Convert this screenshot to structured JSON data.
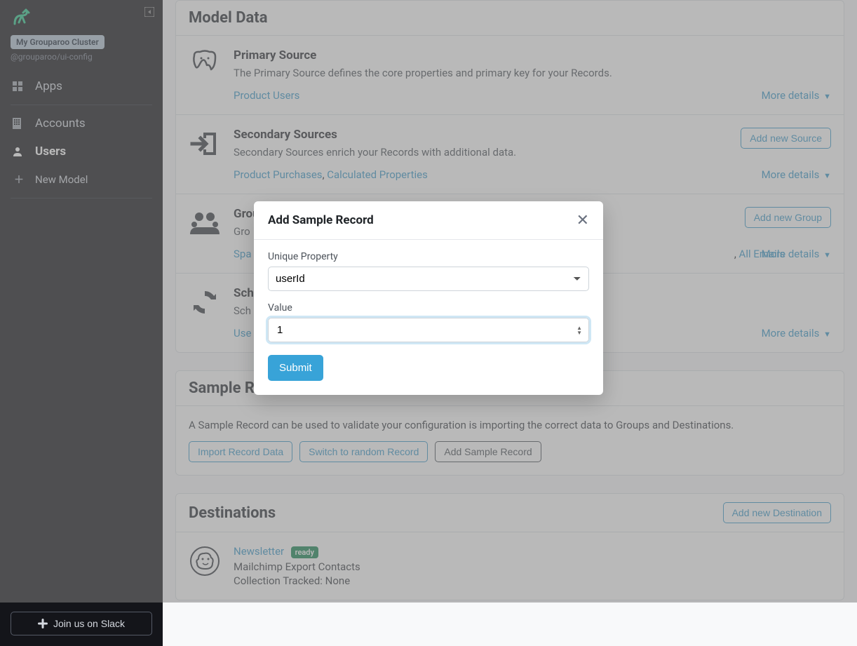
{
  "sidebar": {
    "cluster_name": "My Grouparoo Cluster",
    "cluster_sub": "@grouparoo/ui-config",
    "nav": {
      "apps": "Apps",
      "accounts": "Accounts",
      "users": "Users",
      "new_model": "New Model"
    },
    "slack": "Join us on Slack"
  },
  "sections": {
    "model_data": {
      "title": "Model Data",
      "primary": {
        "title": "Primary Source",
        "desc": "The Primary Source defines the core properties and primary key for your Records.",
        "link1": "Product Users",
        "more": "More details"
      },
      "secondary": {
        "title": "Secondary Sources",
        "desc": "Secondary Sources enrich your Records with additional data.",
        "link1": "Product Purchases",
        "link2": "Calculated Properties",
        "add": "Add new Source",
        "more": "More details"
      },
      "groups": {
        "title": "Groups",
        "desc": "Gro",
        "link1": "Spa",
        "linkmid": "All Emails",
        "add": "Add new Group",
        "more": "More details"
      },
      "schedules": {
        "title": "Sch",
        "desc": "Sch",
        "link1": "Use",
        "more": "More details"
      }
    },
    "sample": {
      "title": "Sample Re",
      "desc": "A Sample Record can be used to validate your configuration is importing the correct data to Groups and Destinations.",
      "import": "Import Record Data",
      "switch": "Switch to random Record",
      "add": "Add Sample Record"
    },
    "destinations": {
      "title": "Destinations",
      "add": "Add new Destination",
      "newsletter": {
        "name": "Newsletter",
        "status": "ready",
        "line1": "Mailchimp Export Contacts",
        "line2": "Collection Tracked: None"
      }
    }
  },
  "modal": {
    "title": "Add Sample Record",
    "label_prop": "Unique Property",
    "select_value": "userId",
    "label_value": "Value",
    "input_value": "1",
    "submit": "Submit"
  }
}
